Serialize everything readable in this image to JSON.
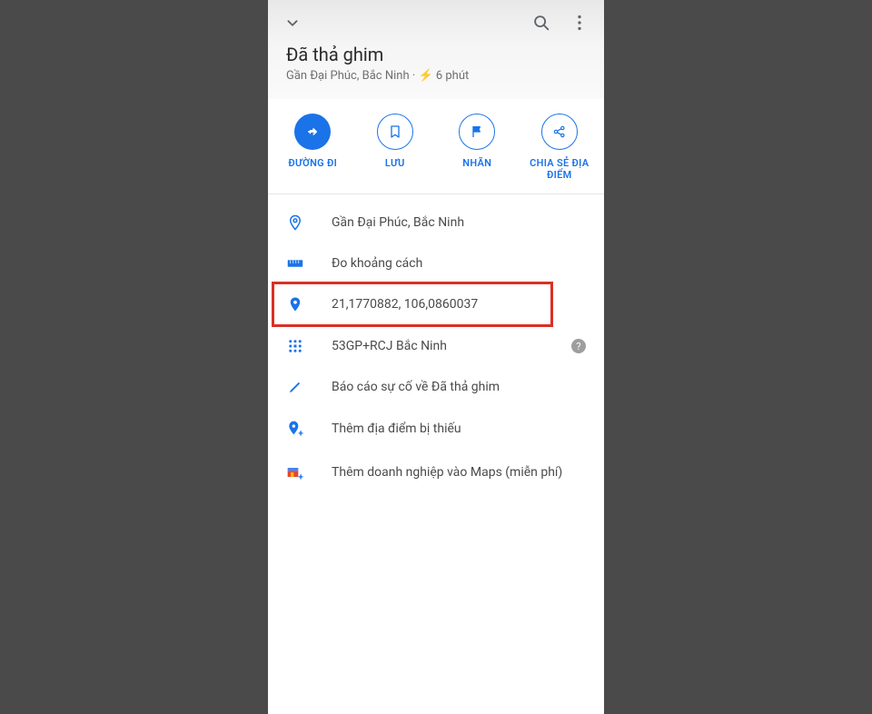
{
  "header": {
    "title": "Đã thả ghim",
    "subtitle": "Gần Đại Phúc, Bắc Ninh · ⚡ 6 phút"
  },
  "actions": {
    "directions": "ĐƯỜNG ĐI",
    "save": "LƯU",
    "label": "NHÃN",
    "share": "CHIA SẺ ĐỊA ĐIỂM"
  },
  "list": {
    "nearby": "Gần Đại Phúc, Bắc Ninh",
    "measure": "Đo khoảng cách",
    "coordinates": "21,1770882, 106,0860037",
    "pluscode": "53GP+RCJ Bắc Ninh",
    "report": "Báo cáo sự cố về Đã thả ghim",
    "addplace": "Thêm địa điểm bị thiếu",
    "addbusiness": "Thêm doanh nghiệp vào Maps (miễn phí)"
  }
}
